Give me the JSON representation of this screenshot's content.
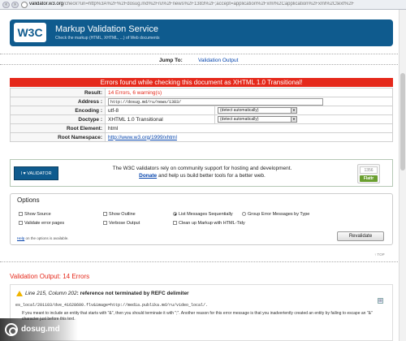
{
  "browser": {
    "url_domain": "validator.w3.org",
    "url_rest": "/check?uri=http%3A%2F%2Fdosug.md%2Fru%2Fnews%2F1383%2F;accept=application%2Fxml%2Capplication%2Fxml%2Ctext%2F"
  },
  "banner": {
    "logo": "W3C",
    "title": "Markup Validation Service",
    "subtitle": "Check the markup (HTML, XHTML, ...) of Web documents"
  },
  "jump": {
    "label": "Jump To:",
    "link": "Validation Output"
  },
  "error_banner": "Errors found while checking this document as XHTML 1.0 Transitional!",
  "results": {
    "result": {
      "label": "Result:",
      "value": "14 Errors, 6 warning(s)"
    },
    "address": {
      "label": "Address :",
      "value": "http://dosug.md/ru/news/1383/"
    },
    "encoding": {
      "label": "Encoding :",
      "value": "utf-8",
      "select": "(detect automatically)"
    },
    "doctype": {
      "label": "Doctype :",
      "value": "XHTML 1.0 Transitional",
      "select": "(detect automatically)"
    },
    "root_element": {
      "label": "Root Element:",
      "value": "html"
    },
    "root_namespace": {
      "label": "Root Namespace:",
      "value": "http://www.w3.org/1999/xhtml"
    }
  },
  "sponsor": {
    "badge": "I ♥ VALIDATOR",
    "line1": "The W3C validators rely on community support for hosting and development.",
    "donate": "Donate",
    "line2_rest": " and help us build better tools for a better web.",
    "flattr_count": "1356",
    "flattr_label": "Flattr"
  },
  "options": {
    "legend": "Options",
    "show_source": "Show Source",
    "show_outline": "Show Outline",
    "list_sequentially": "List Messages Sequentially",
    "group_by_type": "Group Error Messages by Type",
    "validate_error_pages": "Validate error pages",
    "verbose_output": "Verbose Output",
    "clean_up": "Clean up Markup with HTML-Tidy",
    "help_link": "Help",
    "help_rest": " on the options is available.",
    "revalidate": "Revalidate"
  },
  "top_link": "↑ TOP",
  "validation_output": "Validation Output: 14 Errors",
  "first_error": {
    "location": "Line 215, Column 202",
    "message": ": reference not terminated by REFC delimiter",
    "source": "es_local/201103/dve_41628600.flv&image=http://media.publika.md/ru/video_local/.",
    "desc": "If you meant to include an entity that starts with \"&\", then you should terminate it with \";\". Another reason for this error message is that you inadvertently created an entity by failing to escape an \"&\" character just before this text."
  },
  "watermark": "dosug.md"
}
